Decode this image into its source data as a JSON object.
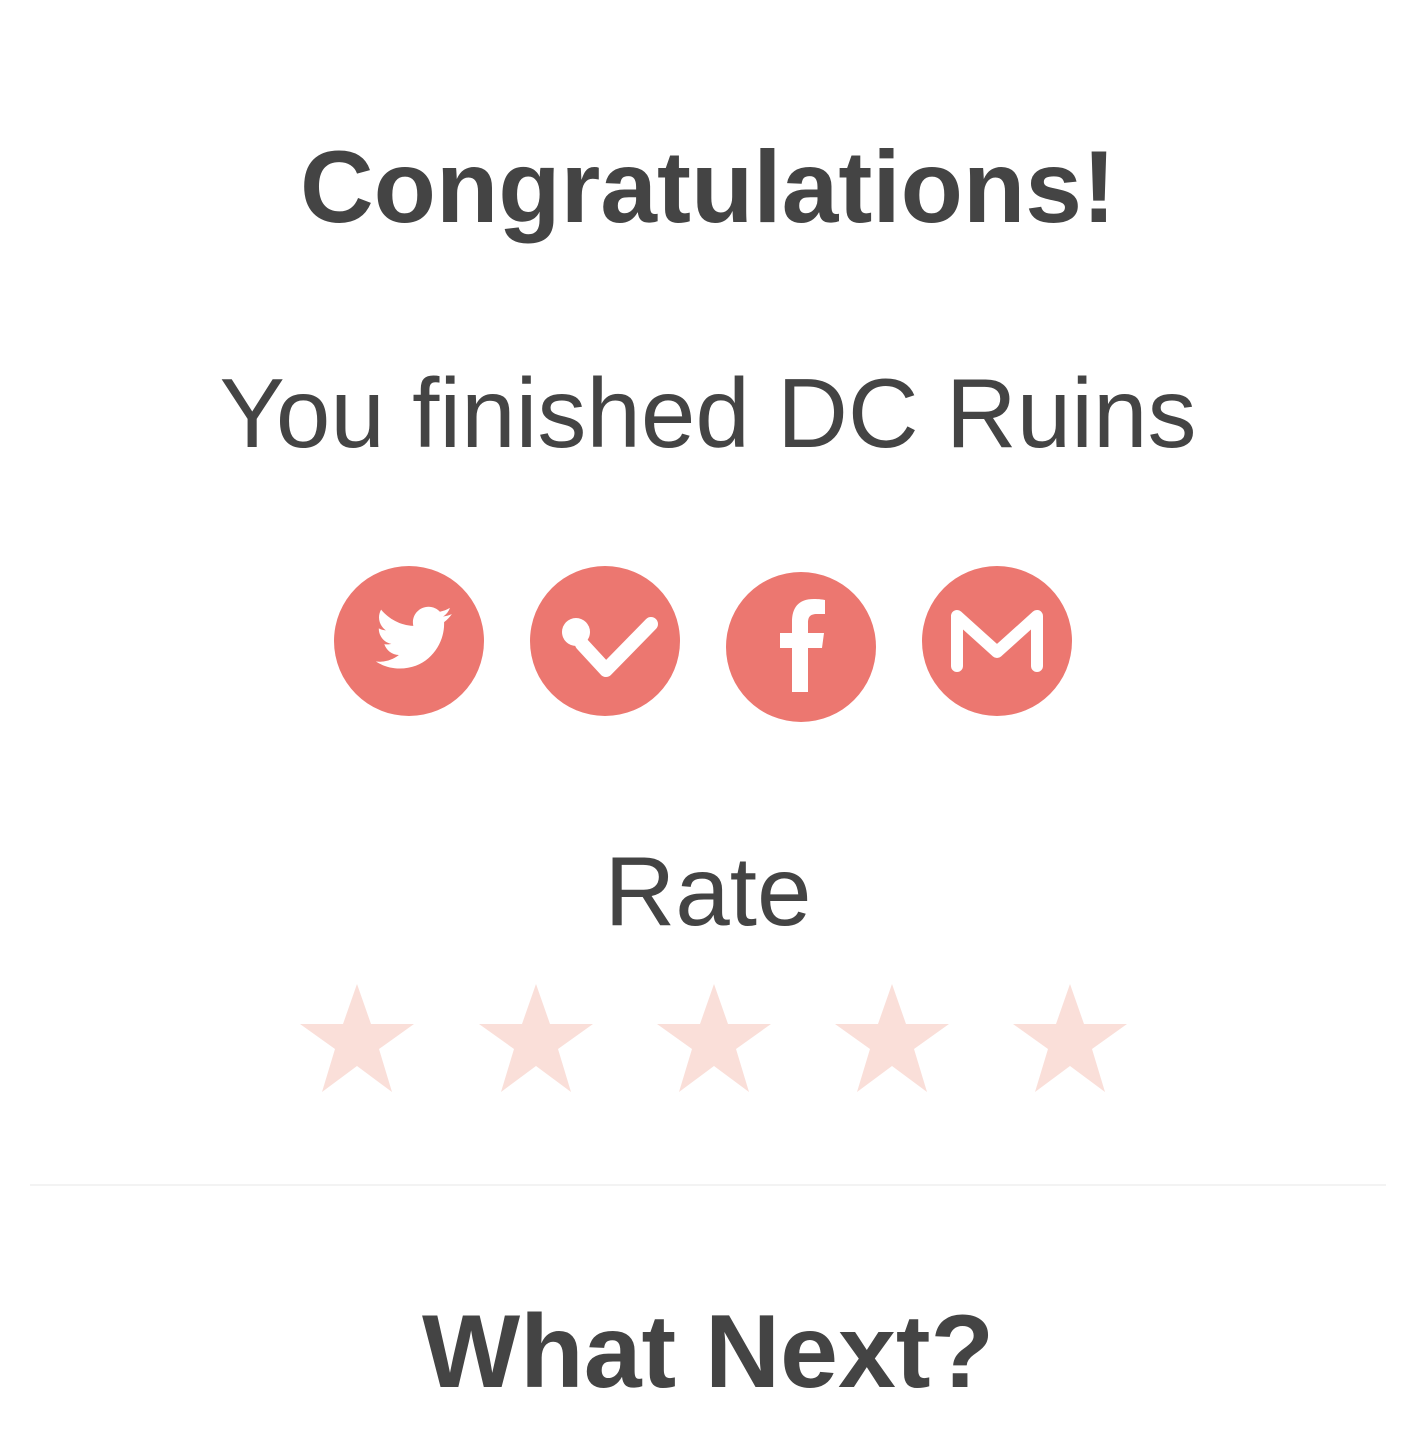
{
  "title": "Congratulations!",
  "subtitle": "You finished DC Ruins",
  "share": {
    "color": "#ec7770",
    "buttons": [
      {
        "icon": "twitter-icon"
      },
      {
        "icon": "check-icon"
      },
      {
        "icon": "facebook-icon"
      },
      {
        "icon": "email-icon"
      }
    ]
  },
  "rating": {
    "label": "Rate",
    "max_stars": 5,
    "selected": 0,
    "star_color": "#fadfd9"
  },
  "next_heading": "What Next?"
}
